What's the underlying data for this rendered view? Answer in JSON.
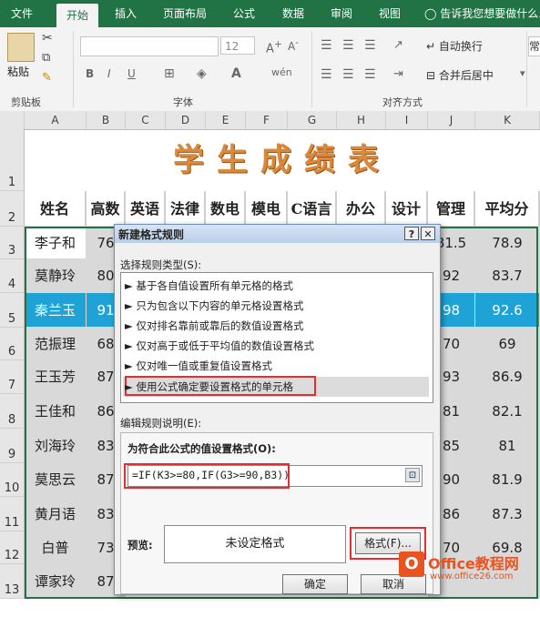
{
  "ribbon": {
    "tabs": [
      "文件",
      "开始",
      "插入",
      "页面布局",
      "公式",
      "数据",
      "审阅",
      "视图"
    ],
    "tell_me": "告诉我您想要做什么...",
    "paste_label": "粘贴",
    "clipboard_label": "剪贴板",
    "font_label": "字体",
    "align_label": "对齐方式",
    "font_size": "12",
    "bold": "B",
    "italic": "I",
    "underline": "U",
    "wrap_text": "自动换行",
    "merge_center": "合并后居中",
    "general_fmt": "常"
  },
  "grid": {
    "columns": [
      "A",
      "B",
      "C",
      "D",
      "E",
      "F",
      "G",
      "H",
      "I",
      "J",
      "K"
    ],
    "row_numbers": [
      "1",
      "2",
      "3",
      "4",
      "5",
      "6",
      "7",
      "8",
      "9",
      "10",
      "11",
      "12",
      "13"
    ],
    "title": "学生成绩表",
    "headers": [
      "姓名",
      "高数",
      "英语",
      "法律",
      "数电",
      "模电",
      "C语言",
      "办公",
      "设计",
      "管理",
      "平均分"
    ],
    "rows": [
      {
        "name": "李子和",
        "b": "76",
        "j": "81.5",
        "k": "78.9"
      },
      {
        "name": "莫静玲",
        "b": "80",
        "j": "92",
        "k": "83.7"
      },
      {
        "name": "秦兰玉",
        "b": "91",
        "j": "98",
        "k": "92.6"
      },
      {
        "name": "范振理",
        "b": "68",
        "j": "70",
        "k": "69"
      },
      {
        "name": "王玉芳",
        "b": "87",
        "j": "93",
        "k": "86.9"
      },
      {
        "name": "王佳和",
        "b": "86",
        "j": "81",
        "k": "82.1"
      },
      {
        "name": "刘海玲",
        "b": "83",
        "j": "85",
        "k": "81"
      },
      {
        "name": "莫思云",
        "b": "87",
        "j": "90",
        "k": "81.9"
      },
      {
        "name": "黄月语",
        "b": "83",
        "j": "86",
        "k": "87.3"
      },
      {
        "name": "白普",
        "b": "73",
        "j": "70",
        "k": "69.8"
      },
      {
        "name": "谭家玲",
        "b": "87",
        "j": "",
        "k": ""
      }
    ]
  },
  "dialog": {
    "title": "新建格式规则",
    "help": "?",
    "close": "✕",
    "rule_type_label": "选择规则类型(S):",
    "rule_types": [
      "► 基于各自值设置所有单元格的格式",
      "► 只为包含以下内容的单元格设置格式",
      "► 仅对排名靠前或靠后的数值设置格式",
      "► 仅对高于或低于平均值的数值设置格式",
      "► 仅对唯一值或重复值设置格式",
      "► 使用公式确定要设置格式的单元格"
    ],
    "edit_label": "编辑规则说明(E):",
    "formula_label": "为符合此公式的值设置格式(O):",
    "formula": "=IF(K3>=80,IF(G3>=90,B3))",
    "preview_label": "预览:",
    "preview_text": "未设定格式",
    "format_button": "格式(F)...",
    "ok": "确定",
    "cancel": "取消"
  },
  "watermark": {
    "brand": "Office教程网",
    "url": "www.office26.com"
  },
  "colors": {
    "excel_green": "#217346",
    "highlight_row": "#1fa3d6",
    "title_orange": "#d88a3a",
    "annotation_red": "#e03030"
  }
}
